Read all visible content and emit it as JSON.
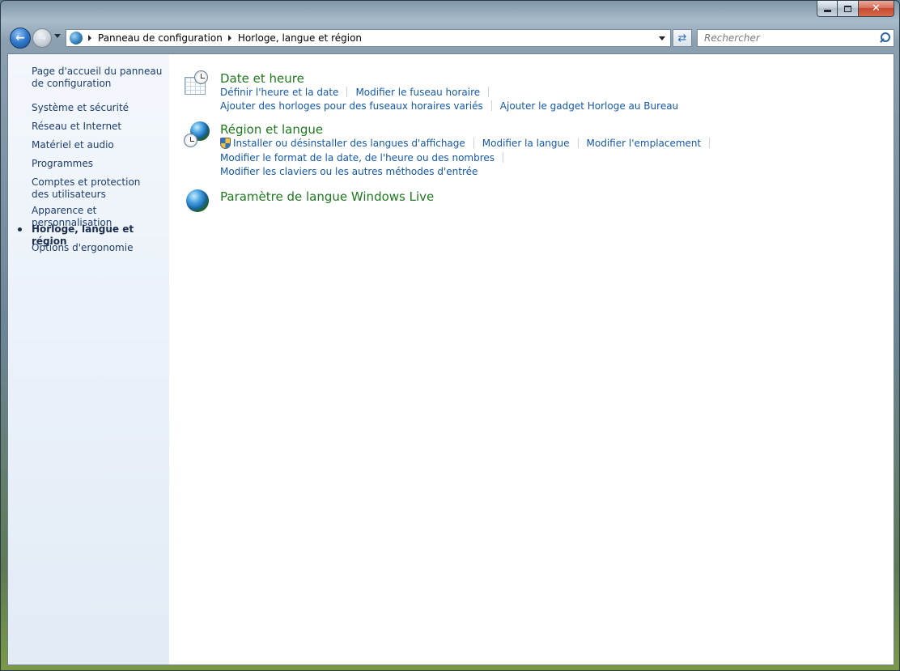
{
  "window": {
    "caption": {
      "minimize": "",
      "maximize": "",
      "close": "✕"
    }
  },
  "nav": {
    "back_icon": "arrow-left-icon",
    "forward_icon": "arrow-right-icon",
    "breadcrumb": [
      "Panneau de configuration",
      "Horloge, langue et région"
    ],
    "search_placeholder": "Rechercher"
  },
  "sidebar": {
    "home": "Page d'accueil du panneau de configuration",
    "items": [
      {
        "label": "Système et sécurité"
      },
      {
        "label": "Réseau et Internet"
      },
      {
        "label": "Matériel et audio"
      },
      {
        "label": "Programmes"
      },
      {
        "label": "Comptes et protection des utilisateurs"
      },
      {
        "label": "Apparence et personnalisation"
      },
      {
        "label": "Horloge, langue et région",
        "active": true
      },
      {
        "label": "Options d'ergonomie"
      }
    ]
  },
  "categories": [
    {
      "title": "Date et heure",
      "icon": "calendar-clock-icon",
      "links": [
        [
          "Définir l'heure et la date",
          "Modifier le fuseau horaire"
        ],
        [
          "Ajouter des horloges pour des fuseaux horaires variés",
          "Ajouter le gadget Horloge au Bureau"
        ]
      ]
    },
    {
      "title": "Région et langue",
      "icon": "globe-clock-icon",
      "links": [
        [
          "Installer ou désinstaller des langues d'affichage",
          "Modifier la langue",
          "Modifier l'emplacement"
        ],
        [
          "Modifier le format de la date, de l'heure ou des nombres"
        ],
        [
          "Modifier les claviers ou les autres méthodes d'entrée"
        ]
      ]
    },
    {
      "title": "Paramètre de langue Windows Live",
      "icon": "globe-icon",
      "links": []
    }
  ]
}
